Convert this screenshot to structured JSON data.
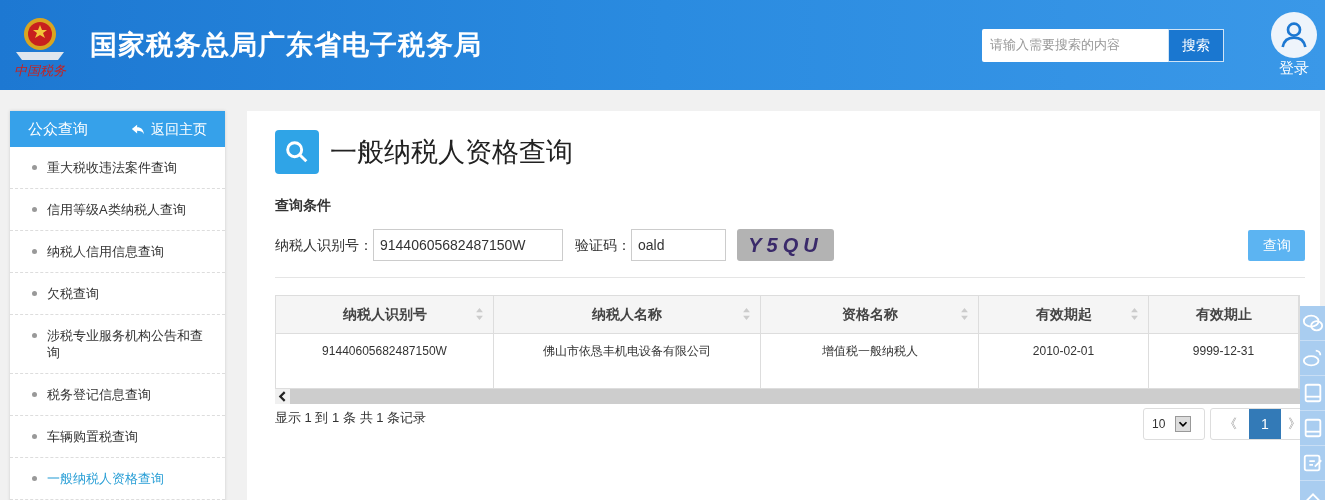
{
  "header": {
    "logo_text": "中国税务",
    "title": "国家税务总局广东省电子税务局",
    "search": {
      "placeholder": "请输入需要搜索的内容",
      "button": "搜索"
    },
    "login": "登录"
  },
  "sidebar": {
    "title": "公众查询",
    "back": "返回主页",
    "items": [
      {
        "label": "重大税收违法案件查询",
        "selected": false
      },
      {
        "label": "信用等级A类纳税人查询",
        "selected": false
      },
      {
        "label": "纳税人信用信息查询",
        "selected": false
      },
      {
        "label": "欠税查询",
        "selected": false
      },
      {
        "label": "涉税专业服务机构公告和查询",
        "selected": false
      },
      {
        "label": "税务登记信息查询",
        "selected": false
      },
      {
        "label": "车辆购置税查询",
        "selected": false
      },
      {
        "label": "一般纳税人资格查询",
        "selected": true
      }
    ]
  },
  "page": {
    "title": "一般纳税人资格查询",
    "conditions_label": "查询条件",
    "fields": {
      "taxpayer_id_label": "纳税人识别号：",
      "taxpayer_id_value": "91440605682487150W",
      "captcha_label": "验证码：",
      "captcha_value": "oald",
      "captcha_image": "Y5QU"
    },
    "query_button": "查询",
    "table": {
      "columns": [
        {
          "label": "纳税人识别号",
          "sortable": true
        },
        {
          "label": "纳税人名称",
          "sortable": true
        },
        {
          "label": "资格名称",
          "sortable": true
        },
        {
          "label": "有效期起",
          "sortable": true
        },
        {
          "label": "有效期止",
          "sortable": false
        }
      ],
      "rows": [
        [
          "91440605682487150W",
          "佛山市依恳丰机电设备有限公司",
          "增值税一般纳税人",
          "2010-02-01",
          "9999-12-31"
        ]
      ]
    },
    "summary": "显示 1 到 1 条 共 1 条记录",
    "pagination": {
      "page_size": "10",
      "prev": "《",
      "pages": [
        {
          "label": "1",
          "selected": true
        }
      ],
      "next": "》"
    }
  }
}
